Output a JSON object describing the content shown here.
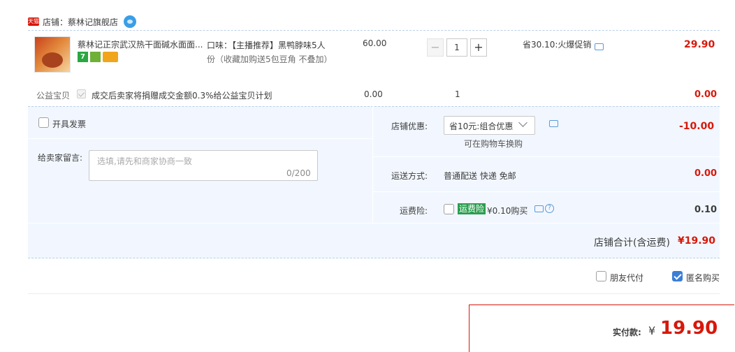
{
  "shop": {
    "badge": "天猫",
    "label": "店铺：蔡林记旗舰店"
  },
  "item": {
    "title": "蔡林记正宗武汉热干面碱水面面...",
    "services": [
      "7",
      "",
      ""
    ],
    "sku_line1": "口味：【主播推荐】黑鸭脖味5人",
    "sku_line2": "份（收藏加购送5包豆角 不叠加）",
    "price": "60.00",
    "qty_minus": "−",
    "quantity": "1",
    "qty_plus": "+",
    "promo": "省30.10:火爆促销",
    "total": "29.90"
  },
  "charity": {
    "label": "公益宝贝",
    "text": "成交后卖家将捐赠成交金额0.3%给公益宝贝计划",
    "price": "0.00",
    "qty": "1",
    "total": "0.00"
  },
  "invoice": {
    "label": "开具发票"
  },
  "message": {
    "label": "给卖家留言:",
    "placeholder": "选填,请先和商家协商一致",
    "count": "0/200"
  },
  "shop_discount": {
    "label": "店铺优惠:",
    "selected": "省10元:组合优惠",
    "hint": "可在购物车换购",
    "value": "-10.00"
  },
  "shipping": {
    "label": "运送方式:",
    "method": "普通配送 快递 免邮",
    "amount": "0.00"
  },
  "insurance": {
    "label": "运费险:",
    "tag": "运费险",
    "price": "¥0.10购买",
    "amount": "0.10"
  },
  "subtotal": {
    "label": "店铺合计(含运费)",
    "value": "¥19.90"
  },
  "options": {
    "friend_pay": "朋友代付",
    "anonymous": "匿名购买"
  },
  "payment": {
    "label": "实付款:",
    "yen": "¥",
    "value": "19.90"
  },
  "colors": {
    "accent_red": "#d7180b",
    "panel_blue": "#f2f7ff",
    "insurance_green": "#2a9e4f"
  }
}
